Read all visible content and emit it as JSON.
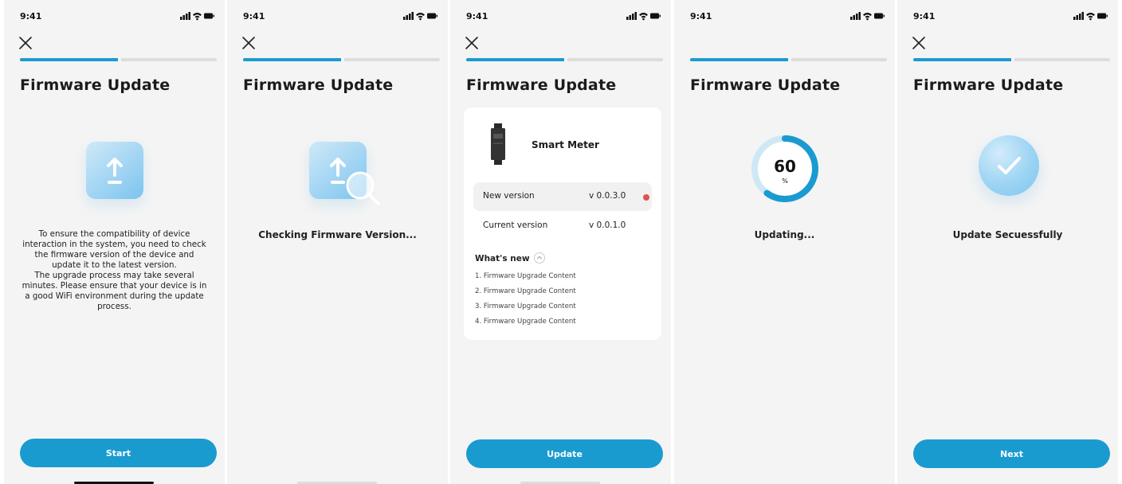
{
  "status_bar": {
    "time": "9:41"
  },
  "screens": [
    {
      "title": "Firmware Update",
      "description": [
        "To ensure the compatibility of device interaction in the system, you need to check the firmware version of the device and update it to the latest version.",
        "The upgrade process may take several minutes. Please ensure that your device is in a good WiFi environment during the update process."
      ],
      "button_label": "Start",
      "step_progress": 0.5
    },
    {
      "title": "Firmware Update",
      "status": "Checking Firmware Version...",
      "step_progress": 0.5
    },
    {
      "title": "Firmware Update",
      "device_name": "Smart Meter",
      "new_version_label": "New version",
      "new_version_value": "v 0.0.3.0",
      "current_version_label": "Current version",
      "current_version_value": "v 0.0.1.0",
      "whats_new_label": "What's new",
      "changes": [
        "1. Firmware Upgrade Content",
        "2. Firmware Upgrade Content",
        "3. Firmware Upgrade Content",
        "4. Firmware Upgrade Content"
      ],
      "button_label": "Update",
      "step_progress": 0.5
    },
    {
      "title": "Firmware Update",
      "progress_value": "60",
      "progress_unit": "%",
      "status": "Updating...",
      "step_progress": 0.5
    },
    {
      "title": "Firmware Update",
      "status": "Update Secuessfully",
      "button_label": "Next",
      "step_progress": 0.5
    }
  ],
  "colors": {
    "accent": "#1a9bd0",
    "track": "#dcdcdc",
    "alert": "#e05252",
    "background": "#f4f4f4"
  },
  "icons": [
    "close-icon",
    "upload-icon",
    "magnifier-icon",
    "check-icon",
    "signal-icon",
    "wifi-icon",
    "battery-icon"
  ]
}
